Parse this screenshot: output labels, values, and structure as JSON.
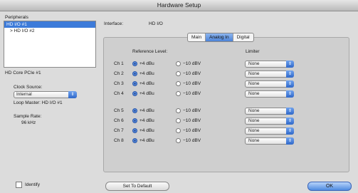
{
  "window": {
    "title": "Hardware Setup"
  },
  "peripherals": {
    "label": "Peripherals",
    "items": [
      "HD I/O #1",
      "> HD I/O #2"
    ],
    "selected_index": 0
  },
  "core_label": "HD Core PCIe #1",
  "clock": {
    "label": "Clock Source:",
    "value": "Internal",
    "loop_master": "Loop Master: HD I/O #1"
  },
  "sample_rate": {
    "label": "Sample Rate:",
    "value": "96 kHz"
  },
  "interface": {
    "label": "Interface:",
    "value": "HD I/O"
  },
  "tabs": [
    {
      "label": "Main",
      "active": false
    },
    {
      "label": "Analog In",
      "active": true
    },
    {
      "label": "Digital",
      "active": false
    }
  ],
  "analog_in": {
    "reference_header": "Reference Level:",
    "limiter_header": "Limiter",
    "option_plus4": "+4 dBu",
    "option_minus10": "−10 dBV",
    "channels": [
      {
        "label": "Ch 1",
        "ref": "+4",
        "limiter": "None"
      },
      {
        "label": "Ch 2",
        "ref": "+4",
        "limiter": "None"
      },
      {
        "label": "Ch 3",
        "ref": "+4",
        "limiter": "None"
      },
      {
        "label": "Ch 4",
        "ref": "+4",
        "limiter": "None"
      },
      {
        "label": "Ch 5",
        "ref": "+4",
        "limiter": "None"
      },
      {
        "label": "Ch 6",
        "ref": "+4",
        "limiter": "None"
      },
      {
        "label": "Ch 7",
        "ref": "+4",
        "limiter": "None"
      },
      {
        "label": "Ch 8",
        "ref": "+4",
        "limiter": "None"
      }
    ]
  },
  "buttons": {
    "identify": "Identify",
    "set_default": "Set To Default",
    "ok": "OK"
  },
  "icons": {
    "select_arrow": "chevron-updown-icon"
  }
}
